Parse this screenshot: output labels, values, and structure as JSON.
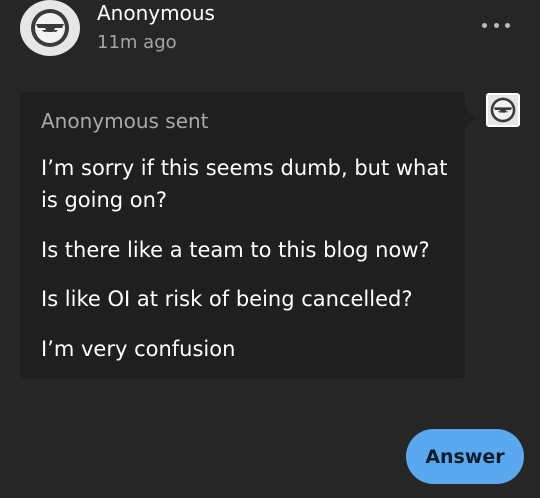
{
  "post": {
    "author": "Anonymous",
    "time": "11m ago"
  },
  "ask": {
    "asker_name": "Anonymous",
    "sent_label": "sent",
    "lines": [
      "I’m sorry if this seems dumb, but what is going on?",
      "Is there like a team to this blog now?",
      "Is like OI at risk of being cancelled?",
      "I’m very confusion"
    ]
  },
  "actions": {
    "answer_label": "Answer"
  },
  "icons": {
    "avatar": "sunglasses-face-icon",
    "more": "more-horizontal-icon"
  },
  "colors": {
    "background": "#262626",
    "card": "#1f1f1f",
    "accent": "#5aa9f0",
    "muted": "#a6a6a6"
  }
}
